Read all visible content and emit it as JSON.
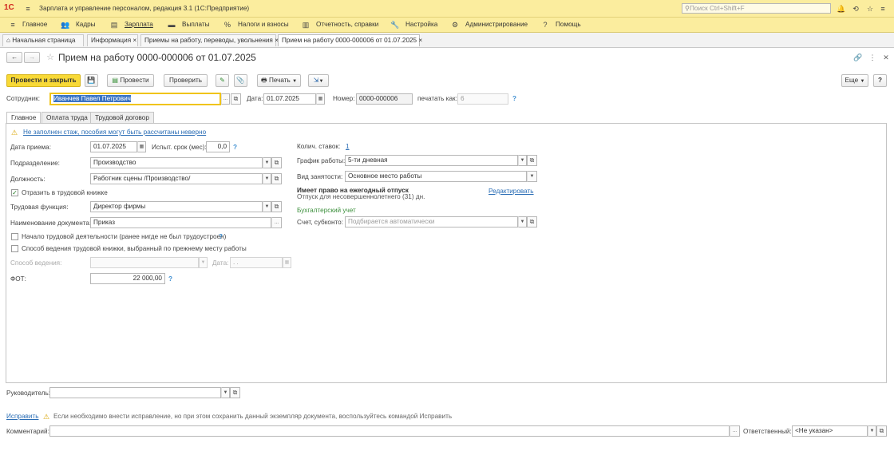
{
  "app": {
    "logo": "1С",
    "title": "Зарплата и управление персоналом, редакция 3.1  (1С:Предприятие)",
    "search_placeholder": "Поиск Ctrl+Shift+F"
  },
  "menu": [
    {
      "label": "Главное",
      "icon": "≡"
    },
    {
      "label": "Кадры",
      "icon": "👥"
    },
    {
      "label": "Зарплата",
      "icon": "▤"
    },
    {
      "label": "Выплаты",
      "icon": "▬"
    },
    {
      "label": "Налоги и взносы",
      "icon": "%"
    },
    {
      "label": "Отчетность, справки",
      "icon": "▥"
    },
    {
      "label": "Настройка",
      "icon": "🔧"
    },
    {
      "label": "Администрирование",
      "icon": "⚙"
    },
    {
      "label": "Помощь",
      "icon": "?"
    }
  ],
  "tabs": [
    {
      "label": "Начальная страница"
    },
    {
      "label": "Информация"
    },
    {
      "label": "Приемы на работу, переводы, увольнения"
    },
    {
      "label": "Прием на работу 0000-000006 от 01.07.2025"
    }
  ],
  "doc": {
    "title": "Прием на работу 0000-000006 от 01.07.2025"
  },
  "toolbar": {
    "post_close": "Провести и закрыть",
    "post": "Провести",
    "check": "Проверить",
    "print": "Печать",
    "more": "Еще",
    "help": "?"
  },
  "header": {
    "employee_label": "Сотрудник:",
    "employee_value": "Иванчев Павел Петрович",
    "date_label": "Дата:",
    "date_value": "01.07.2025",
    "number_label": "Номер:",
    "number_value": "0000-000006",
    "print_as_label": "печатать как:",
    "print_as_value": "6"
  },
  "form_tabs": [
    {
      "label": "Главное"
    },
    {
      "label": "Оплата труда"
    },
    {
      "label": "Трудовой договор"
    }
  ],
  "main": {
    "warning": "Не заполнен стаж, пособия могут быть рассчитаны неверно",
    "hire_date_label": "Дата приема:",
    "hire_date_value": "01.07.2025",
    "probation_label": "Испыт. срок (мес):",
    "probation_value": "0,0",
    "dept_label": "Подразделение:",
    "dept_value": "Производство",
    "position_label": "Должность:",
    "position_value": "Работник сцены /Производство/",
    "workbook_label": "Отразить в трудовой книжке",
    "labor_func_label": "Трудовая функция:",
    "labor_func_value": "Директор фирмы",
    "doc_name_label": "Наименование документа:",
    "doc_name_value": "Приказ",
    "first_work_label": "Начало трудовой деятельности (ранее нигде не был трудоустроен)",
    "workbook_method_label": "Способ ведения трудовой книжки, выбранный по прежнему месту работы",
    "method_label": "Способ ведения:",
    "method_date_label": "Дата:",
    "method_date_value": ". .",
    "fot_label": "ФОТ:",
    "fot_value": "22 000,00",
    "rates_label": "Колич. ставок:",
    "rates_value": "1",
    "schedule_label": "График работы:",
    "schedule_value": "5-ти дневная",
    "employment_label": "Вид занятости:",
    "employment_value": "Основное место работы",
    "vacation_title": "Имеет право на ежегодный отпуск",
    "vacation_edit": "Редактировать",
    "vacation_text": "Отпуск для несовершеннолетнего (31) дн.",
    "accounting_title": "Бухгалтерский учет",
    "account_label": "Счет, субконто:",
    "account_placeholder": "Подбирается автоматически"
  },
  "footer": {
    "manager_label": "Руководитель:",
    "fix_link": "Исправить",
    "fix_text": "Если необходимо внести исправление, но при этом сохранить данный экземпляр документа, воспользуйтесь командой Исправить",
    "comment_label": "Комментарий:",
    "responsible_label": "Ответственный:",
    "responsible_value": "<Не указан>"
  }
}
